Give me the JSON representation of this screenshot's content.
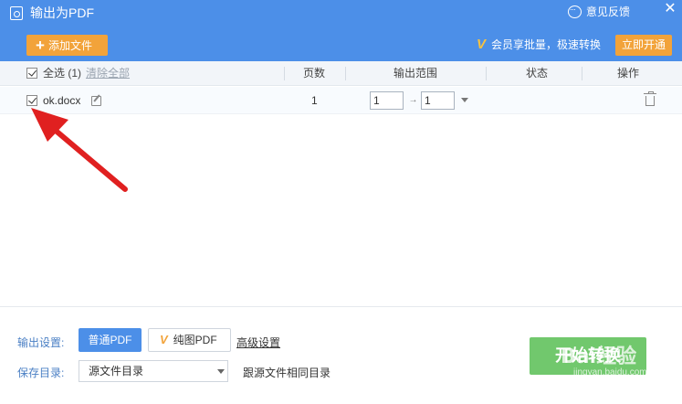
{
  "window": {
    "title": "输出为PDF",
    "feedback_label": "意见反馈",
    "close_glyph": "✕"
  },
  "toolbar": {
    "add_icon": "+",
    "add_label": "添加文件",
    "vip_icon": "V",
    "vip_text": "会员享批量，极速转换",
    "open_label": "立即开通"
  },
  "table": {
    "select_all_label": "全选 (1)",
    "clear_all_label": "清除全部",
    "columns": {
      "pages": "页数",
      "range": "输出范围",
      "status": "状态",
      "actions": "操作"
    },
    "rows": [
      {
        "checked": true,
        "filename": "ok.docx",
        "pages": "1",
        "range_from": "1",
        "range_arrow": "→",
        "range_to": "1",
        "status": ""
      }
    ]
  },
  "footer": {
    "output_settings_label": "输出设置:",
    "normal_pdf_label": "普通PDF",
    "pure_pdf_icon": "V",
    "pure_pdf_label": "纯图PDF",
    "advanced_label": "高级设置",
    "save_dir_label": "保存目录:",
    "save_dir_value": "源文件目录",
    "save_dir_hint": "跟源文件相同目录",
    "start_label": "开始转换"
  },
  "watermark": {
    "text": "Bai经验",
    "sub": "jingyan.baidu.com"
  },
  "colors": {
    "header_blue": "#4c8fe8",
    "accent_orange": "#f2a33a",
    "start_green": "#71c86d",
    "annotation_red": "#e02020"
  }
}
